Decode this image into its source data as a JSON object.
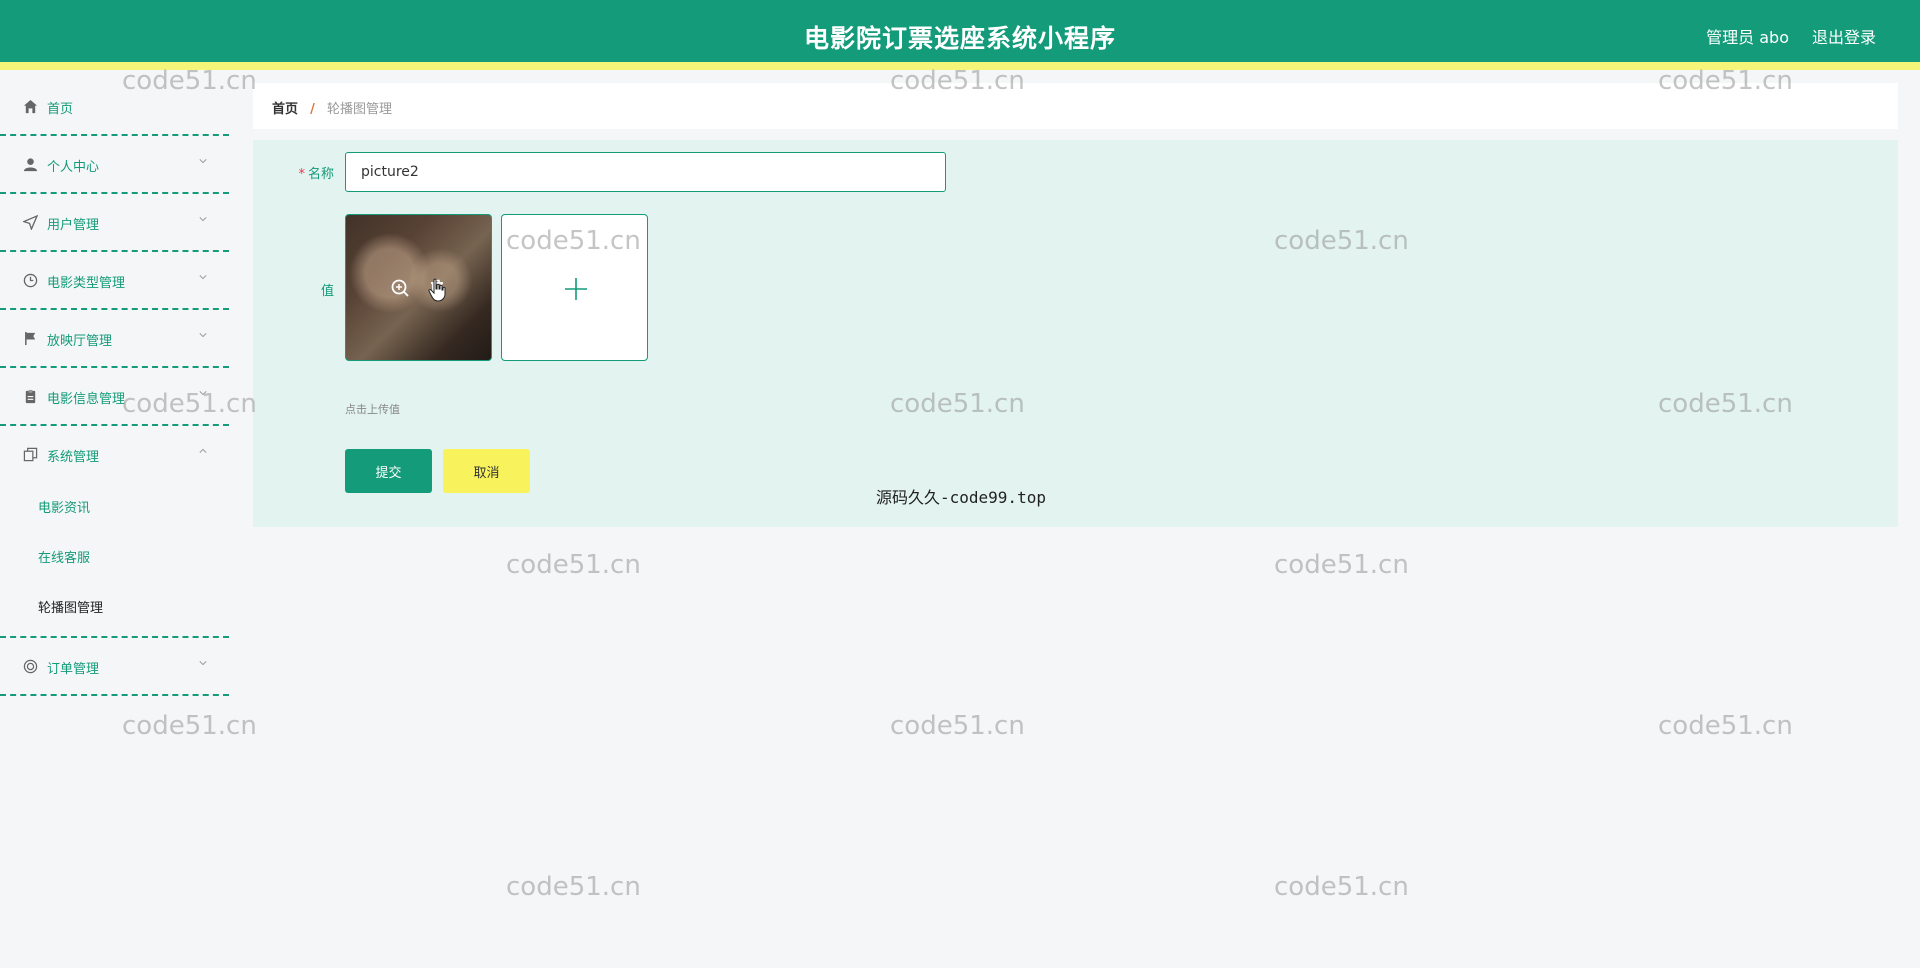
{
  "header": {
    "title": "电影院订票选座系统小程序",
    "user": "管理员 abo",
    "logout": "退出登录"
  },
  "sidebar": {
    "items": [
      {
        "label": "首页",
        "icon": "home-icon",
        "chevron": false
      },
      {
        "label": "个人中心",
        "icon": "user-icon",
        "chevron": true
      },
      {
        "label": "用户管理",
        "icon": "send-icon",
        "chevron": true
      },
      {
        "label": "电影类型管理",
        "icon": "clock-icon",
        "chevron": true
      },
      {
        "label": "放映厅管理",
        "icon": "flag-icon",
        "chevron": true
      },
      {
        "label": "电影信息管理",
        "icon": "clipboard-icon",
        "chevron": true
      },
      {
        "label": "系统管理",
        "icon": "copy-icon",
        "chevron": true
      },
      {
        "label": "订单管理",
        "icon": "target-icon",
        "chevron": true
      }
    ],
    "system_sub": [
      "电影资讯",
      "在线客服",
      "轮播图管理"
    ]
  },
  "breadcrumb": {
    "home": "首页",
    "separator": "/",
    "current": "轮播图管理"
  },
  "form": {
    "name_label": "名称",
    "name_required": "*",
    "name_value": "picture2",
    "value_label": "值",
    "upload_hint": "点击上传值",
    "submit": "提交",
    "cancel": "取消"
  },
  "watermark": "code51.cn",
  "source_mark": "源码久久-code99.top",
  "colors": {
    "primary": "#139b7a",
    "accent_yellow": "#f8f35c",
    "panel": "#e3f3ef"
  }
}
